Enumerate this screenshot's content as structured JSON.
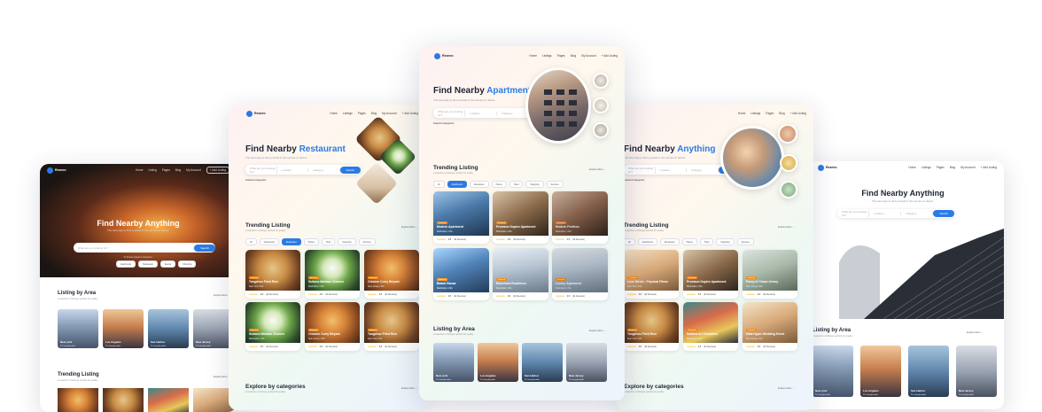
{
  "colors": {
    "accent": "#2b7be5",
    "badge": "#f28a1a",
    "star": "#f5b400"
  },
  "card1": {
    "brand": "Rezeeo",
    "nav": [
      "Home",
      "Listing",
      "Pages",
      "Blog",
      "My Account"
    ],
    "add_listing": "+ Add Listing",
    "hero_title": "Find Nearby Anything",
    "hero_sub": "The best way to find yourself in the service of others.",
    "search_placeholder": "What are you looking for?",
    "search_btn": "Search",
    "popular": "Or browse featured categories:",
    "popular_chips": [
      "Apartments",
      "Restaurant",
      "Events",
      "Shopping"
    ],
    "area_title": "Listing by Area",
    "area_sub": "A selection of listings verified for quality",
    "explore": "Explore More →",
    "areas": [
      {
        "name": "New york",
        "count": "20 Listing Available"
      },
      {
        "name": "Los Angeles",
        "count": "20 Listing Available"
      },
      {
        "name": "San Harbor",
        "count": "20 Listing Available"
      },
      {
        "name": "New Jersey",
        "count": "20 Listing Available"
      }
    ],
    "trending_title": "Trending Listing",
    "trending_sub": "A selection of listings verified for quality"
  },
  "card2": {
    "brand": "Rezeeo",
    "nav": [
      "Home",
      "Listings",
      "Pages",
      "Blog",
      "My Account"
    ],
    "add_listing": "+ Add Listing",
    "hero_title_a": "Find Nearby ",
    "hero_title_b": "Restaurant",
    "hero_sub": "The best way to find yourself in the service of others.",
    "search_fields": [
      "What are you looking for?",
      "Location",
      "Category"
    ],
    "search_btn": "Search",
    "featured": "Featured categories:",
    "trending_title": "Trending Listing",
    "trending_sub": "A selection of listings verified for quality",
    "explore": "Explore More →",
    "chips": [
      "All",
      "Apartments",
      "Restaurant",
      "Places",
      "Hotel",
      "Shopping",
      "Services"
    ],
    "listings": [
      {
        "title": "Tangzhou Fried Rice",
        "loc": "New York, USA",
        "rating": "4.5",
        "reviews": "(2k Reviews)",
        "badge": "Featured"
      },
      {
        "title": "Sultana Malabar Chicken",
        "loc": "Manhattan, USA",
        "rating": "4.5",
        "reviews": "(2k Reviews)",
        "badge": "Featured"
      },
      {
        "title": "Chicken Curry Biryani",
        "loc": "New Jersey, USA",
        "rating": "4.5",
        "reviews": "(2k Reviews)",
        "badge": "Featured"
      },
      {
        "title": "Sultana Malabar Chicken",
        "loc": "Manhattan, USA",
        "rating": "4.5",
        "reviews": "(2k Reviews)",
        "badge": "Featured"
      },
      {
        "title": "Chicken Curry Biryani",
        "loc": "New Jersey, USA",
        "rating": "4.5",
        "reviews": "(2k Reviews)",
        "badge": "Featured"
      },
      {
        "title": "Tangzhou Fried Rice",
        "loc": "New York, USA",
        "rating": "4.5",
        "reviews": "(2k Reviews)",
        "badge": "Featured"
      }
    ],
    "cat_title": "Explore by categories",
    "cat_sub": "A selection of listings verified for quality"
  },
  "card3": {
    "brand": "Rezeeo",
    "nav": [
      "Home",
      "Listings",
      "Pages",
      "Blog",
      "My Account"
    ],
    "add_listing": "+ Add Listing",
    "hero_title_a": "Find Nearby ",
    "hero_title_b": "Apartment",
    "hero_sub": "The best way to find yourself in the service of others.",
    "search_fields": [
      "What are you looking for?",
      "Location",
      "Category"
    ],
    "search_btn": "Search",
    "featured": "Featured categories:",
    "trending_title": "Trending Listing",
    "trending_sub": "A selection of listings verified for quality",
    "explore": "Explore More →",
    "chips": [
      "All",
      "Apartments",
      "Restaurant",
      "Places",
      "Hotel",
      "Shopping",
      "Services"
    ],
    "listings": [
      {
        "title": "Modern Apartment",
        "loc": "Manhattan, USA",
        "rating": "4.5",
        "reviews": "(2k Reviews)",
        "badge": "Featured"
      },
      {
        "title": "Premium Duplex Apartment",
        "loc": "Manhattan, USA",
        "rating": "4.5",
        "reviews": "(2k Reviews)",
        "badge": "Featured"
      },
      {
        "title": "Modern Penthou",
        "loc": "Manhattan, USA",
        "rating": "4.5",
        "reviews": "(2k Reviews)",
        "badge": "Featured"
      },
      {
        "title": "Beach House",
        "loc": "Manhattan, USA",
        "rating": "4.5",
        "reviews": "(2k Reviews)",
        "badge": "Featured"
      },
      {
        "title": "Riverfront Residence",
        "loc": "Manhattan, USA",
        "rating": "4.5",
        "reviews": "(2k Reviews)",
        "badge": "Featured"
      },
      {
        "title": "Luxury Apartment",
        "loc": "Manhattan, USA",
        "rating": "4.5",
        "reviews": "(2k Reviews)",
        "badge": "Featured"
      }
    ],
    "area_title": "Listing by Area",
    "area_sub": "A selection of listings verified for quality",
    "areas": [
      {
        "name": "New york",
        "count": "20 Listing Available"
      },
      {
        "name": "Los Angeles",
        "count": "20 Listing Available"
      },
      {
        "name": "San Harbor",
        "count": "20 Listing Available"
      },
      {
        "name": "New Jersey",
        "count": "20 Listing Available"
      }
    ]
  },
  "card4": {
    "nav": [
      "Home",
      "Listings",
      "Pages",
      "Blog"
    ],
    "add_listing": "+ Add Listing",
    "hero_title_a": "Find Nearby ",
    "hero_title_b": "Anything",
    "hero_sub": "The best way to find yourself in the service of others.",
    "search_fields": [
      "What are you looking for?",
      "Location",
      "Category"
    ],
    "search_btn": "Search",
    "featured": "Featured categories:",
    "trending_title": "Trending Listing",
    "trending_sub": "A selection of listings verified for quality",
    "explore": "Explore More →",
    "chips": [
      "All",
      "Apartments",
      "Restaurant",
      "Places",
      "Hotel",
      "Shopping",
      "Services"
    ],
    "listings": [
      {
        "title": "Luxe Street - Physical Fitnes",
        "loc": "New York, USA",
        "rating": "4.5",
        "reviews": "(2k Reviews)",
        "badge": "Featured"
      },
      {
        "title": "Premium Duplex Apartment",
        "loc": "Manhattan, USA",
        "rating": "4.5",
        "reviews": "(2k Reviews)",
        "badge": "Featured"
      },
      {
        "title": "Forey of Chase Jersey",
        "loc": "New Jersey, USA",
        "rating": "4.5",
        "reviews": "(2k Reviews)",
        "badge": "Featured"
      },
      {
        "title": "Tangzhou Fried Rice",
        "loc": "New York, USA",
        "rating": "4.5",
        "reviews": "(2k Reviews)",
        "badge": "Featured"
      },
      {
        "title": "Sultana Art Exhibition",
        "loc": "Manhattan, USA",
        "rating": "4.5",
        "reviews": "(2k Reviews)",
        "badge": "Featured"
      },
      {
        "title": "Data Hyper Wedding Event",
        "loc": "New Jersey, USA",
        "rating": "4.5",
        "reviews": "(2k Reviews)",
        "badge": "Featured"
      }
    ],
    "cat_title": "Explore by categories",
    "cat_sub": "A selection of listings verified for quality"
  },
  "card5": {
    "brand": "Rezeeo",
    "nav": [
      "Home",
      "Listings",
      "Pages",
      "Blog",
      "My Account"
    ],
    "add_listing": "+ Add Listing",
    "hero_title": "Find Nearby Anything",
    "hero_sub": "The best way to find yourself in the service of others.",
    "search_fields": [
      "What are you looking for?",
      "Location",
      "Category"
    ],
    "search_btn": "Search",
    "area_title": "Listing by Area",
    "area_sub": "A selection of listings verified for quality",
    "explore": "Explore More →",
    "areas": [
      {
        "name": "New york",
        "count": "20 Listing Available"
      },
      {
        "name": "Los Angeles",
        "count": "20 Listing Available"
      },
      {
        "name": "San Harbor",
        "count": "20 Listing Available"
      },
      {
        "name": "New Jersey",
        "count": "20 Listing Available"
      }
    ]
  }
}
